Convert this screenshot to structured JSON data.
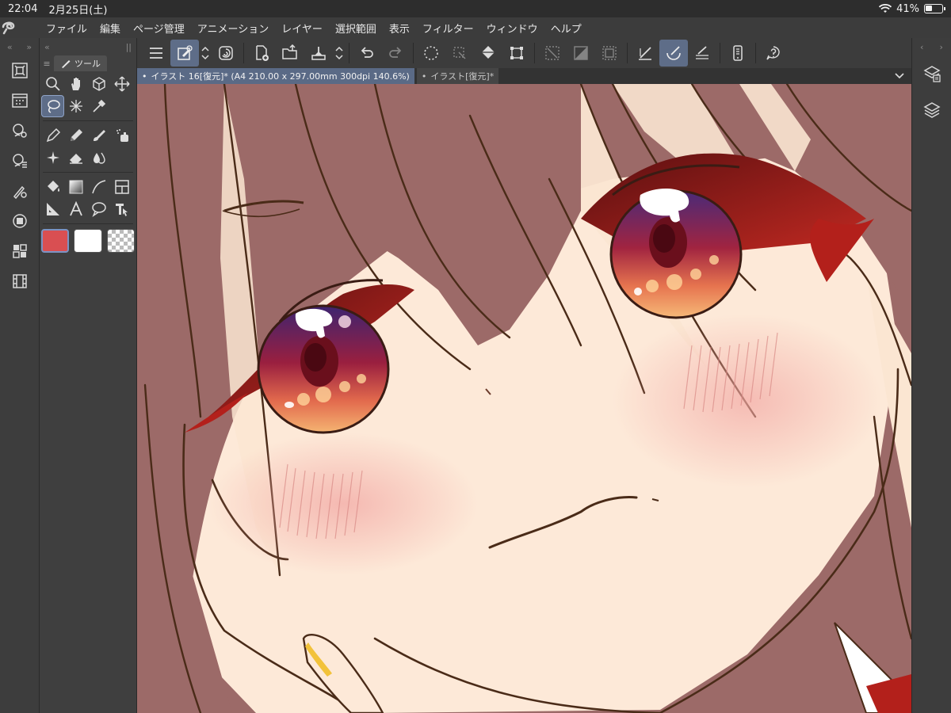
{
  "status_bar": {
    "time": "22:04",
    "date": "2月25日(土)",
    "battery": "41%"
  },
  "menu": {
    "logo_icon": "clip-studio-logo-icon",
    "items": [
      "ファイル",
      "編集",
      "ページ管理",
      "アニメーション",
      "レイヤー",
      "選択範囲",
      "表示",
      "フィルター",
      "ウィンドウ",
      "ヘルプ"
    ]
  },
  "tool_panel": {
    "tab_label": "ツール",
    "tools": [
      "zoom-icon",
      "hand-icon",
      "3d-object-icon",
      "move-icon",
      "lasso-select-icon",
      "magic-wand-icon",
      "eyedropper-icon",
      "",
      "pen-icon",
      "pencil-icon",
      "brush-icon",
      "airbrush-icon",
      "decoration-icon",
      "eraser-icon",
      "blend-icon",
      "",
      "fill-icon",
      "gradient-icon",
      "curve-icon",
      "frame-border-icon",
      "ruler-icon",
      "text-icon",
      "balloon-icon",
      "operation-icon"
    ],
    "active_tool": "lasso-select-icon",
    "main_color": "#d94f52",
    "sub_color": "#ffffff"
  },
  "command_bar": {
    "buttons": [
      "menu-icon",
      "auto-select-icon",
      "up-down-icon",
      "lasso-fill-icon",
      "new-canvas-icon",
      "open-icon",
      "save-icon",
      "up-down-icon",
      "undo-icon",
      "redo-icon",
      "select-all-icon",
      "deselect-icon",
      "fill-selection-icon",
      "transform-icon",
      "clear-outside-icon",
      "invert-icon",
      "selection-border-icon",
      "snap-ruler-icon",
      "snap-special-ruler-icon",
      "snap-grid-icon",
      "smartphone-connect-icon",
      "help-icon"
    ]
  },
  "doc_tabs": [
    {
      "label": "イラスト 16[復元]* (A4 210.00 x 297.00mm 300dpi 140.6%)",
      "active": true
    },
    {
      "label": "イラスト[復元]*",
      "active": false
    }
  ],
  "left_column": {
    "buttons": [
      "navigator-icon",
      "sub-view-icon",
      "tool-property-icon",
      "brush-size-icon",
      "color-icon",
      "color-circle-icon",
      "layer-property-icon",
      "timeline-icon"
    ]
  },
  "right_column": {
    "buttons": [
      "layer-property-icon",
      "layers-icon"
    ]
  },
  "colors": {
    "accent": "#5e6d88",
    "canvas_hair": "#9c6a68",
    "skin": "#fde9d8",
    "eye_red": "#b3201b"
  }
}
